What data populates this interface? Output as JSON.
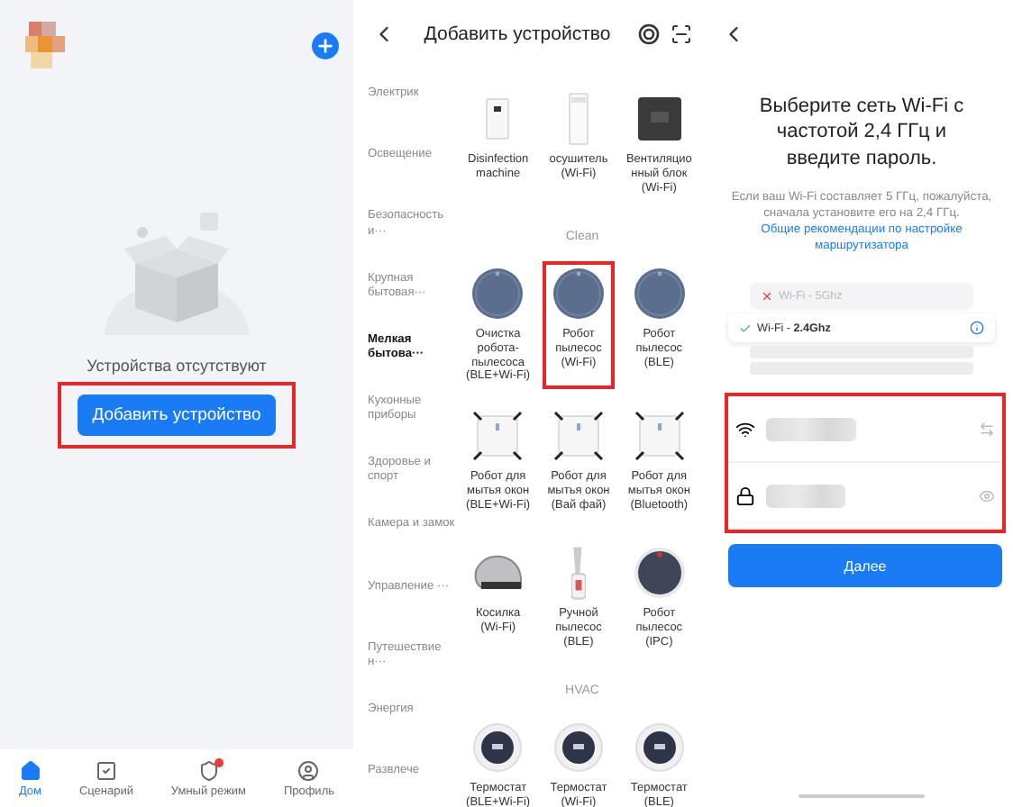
{
  "home_screen": {
    "empty_text": "Устройства отсутствуют",
    "add_button": {
      "label": "Добавить устройство",
      "highlighted": true
    },
    "nav": [
      {
        "label": "Дом",
        "selected": true,
        "badge": false
      },
      {
        "label": "Сценарий",
        "selected": false,
        "badge": false
      },
      {
        "label": "Умный режим",
        "selected": false,
        "badge": true
      },
      {
        "label": "Профиль",
        "selected": false,
        "badge": false
      }
    ]
  },
  "add_device_screen": {
    "title": "Добавить устройство",
    "categories": [
      {
        "label": "Электрик",
        "selected": false
      },
      {
        "label": "Освещение",
        "selected": false
      },
      {
        "label": "Безопасность и···",
        "selected": false
      },
      {
        "label": "Крупная бытовая···",
        "selected": false
      },
      {
        "label": "Мелкая бытова···",
        "selected": true
      },
      {
        "label": "Кухонные приборы",
        "selected": false
      },
      {
        "label": "Здоровье и спорт",
        "selected": false
      },
      {
        "label": "Камера и замок",
        "selected": false
      },
      {
        "label": "Управление ···",
        "selected": false
      },
      {
        "label": "Путешествие н···",
        "selected": false
      },
      {
        "label": "Энергия",
        "selected": false
      },
      {
        "label": "Развлече",
        "selected": false
      }
    ],
    "groups": [
      {
        "devices": [
          {
            "label": "Disinfection machine",
            "kind": "box",
            "highlighted": false
          },
          {
            "label": "осушитель (Wi-Fi)",
            "kind": "tower",
            "highlighted": false
          },
          {
            "label": "Вентиляционный блок (Wi-Fi)",
            "kind": "panel",
            "highlighted": false
          }
        ]
      },
      {
        "heading": "Clean",
        "devices": [
          {
            "label": "Очистка робота-пылесоса (BLE+Wi-Fi)",
            "kind": "vacuum",
            "highlighted": false
          },
          {
            "label": "Робот пылесос (Wi-Fi)",
            "kind": "vacuum",
            "highlighted": true
          },
          {
            "label": "Робот пылесос (BLE)",
            "kind": "vacuum",
            "highlighted": false
          },
          {
            "label": "Робот для мытья окон (BLE+Wi-Fi)",
            "kind": "window",
            "highlighted": false
          },
          {
            "label": "Робот для мытья окон (Вай фай)",
            "kind": "window",
            "highlighted": false
          },
          {
            "label": "Робот для мытья окон (Bluetooth)",
            "kind": "window",
            "highlighted": false
          },
          {
            "label": "Косилка (Wi-Fi)",
            "kind": "mower",
            "highlighted": false
          },
          {
            "label": "Ручной пылесос (BLE)",
            "kind": "handheld",
            "highlighted": false
          },
          {
            "label": "Робот пылесос (IPC)",
            "kind": "vacuum_dark",
            "highlighted": false
          }
        ]
      },
      {
        "heading": "HVAC",
        "devices": [
          {
            "label": "Термостат (BLE+Wi-Fi)",
            "kind": "thermostat",
            "highlighted": false
          },
          {
            "label": "Термостат (Wi-Fi)",
            "kind": "thermostat",
            "highlighted": false
          },
          {
            "label": "Термостат (BLE)",
            "kind": "thermostat",
            "highlighted": false
          }
        ]
      }
    ]
  },
  "wifi_screen": {
    "title": "Выберите сеть Wi-Fi с частотой 2,4 ГГц и введите пароль.",
    "description": "Если ваш Wi-Fi составляет 5 ГГц, пожалуйста, сначала установите его на 2,4 ГГц.",
    "link": "Общие рекомендации по настройке маршрутизатора",
    "networks": [
      {
        "label": "Wi-Fi - 5Ghz",
        "kind": "rejected"
      },
      {
        "label": "Wi-Fi - **2.4Ghz**",
        "kind": "accepted"
      }
    ],
    "fields_highlighted": true,
    "fields": [
      {
        "kind": "network"
      },
      {
        "kind": "password"
      }
    ],
    "next_button": "Далее"
  }
}
